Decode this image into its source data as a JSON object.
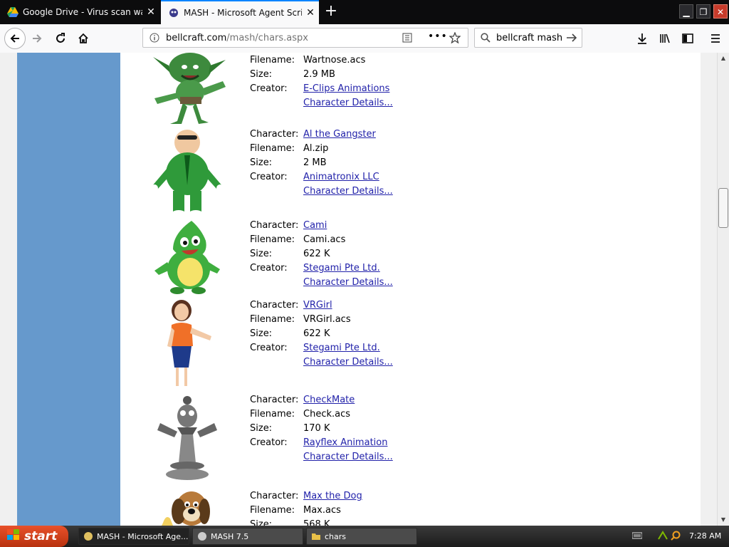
{
  "browser": {
    "tabs": [
      {
        "title": "Google Drive - Virus scan warning",
        "active": false
      },
      {
        "title": "MASH - Microsoft Agent Scripting H",
        "active": true
      }
    ],
    "url_domain": "bellcraft.com",
    "url_path": "/mash/chars.aspx",
    "search_value": "bellcraft mash"
  },
  "labels": {
    "character": "Character:",
    "filename": "Filename:",
    "size": "Size:",
    "creator": "Creator:",
    "details": "Character Details..."
  },
  "characters": [
    {
      "name": "",
      "filename": "Wartnose.acs",
      "size": "2.9 MB",
      "creator": "E-Clips Animations",
      "image": "troll-icon"
    },
    {
      "name": "Al the Gangster",
      "filename": "Al.zip",
      "size": "2 MB",
      "creator": "Animatronix LLC",
      "image": "gangster-icon"
    },
    {
      "name": "Cami",
      "filename": "Cami.acs",
      "size": "622 K",
      "creator": "Stegami Pte Ltd.",
      "image": "chameleon-icon"
    },
    {
      "name": "VRGirl",
      "filename": "VRGirl.acs",
      "size": "622 K",
      "creator": "Stegami Pte Ltd.",
      "image": "girl-icon"
    },
    {
      "name": "CheckMate",
      "filename": "Check.acs",
      "size": "170 K",
      "creator": "Rayflex Animation",
      "image": "chess-king-icon"
    },
    {
      "name": "Max the Dog",
      "filename": "Max.acs",
      "size": "568 K",
      "creator": "",
      "image": "dog-icon"
    }
  ],
  "taskbar": {
    "start": "start",
    "tasks": [
      "MASH - Microsoft Age...",
      "MASH 7.5",
      "chars"
    ],
    "clock": "7:28 AM"
  }
}
